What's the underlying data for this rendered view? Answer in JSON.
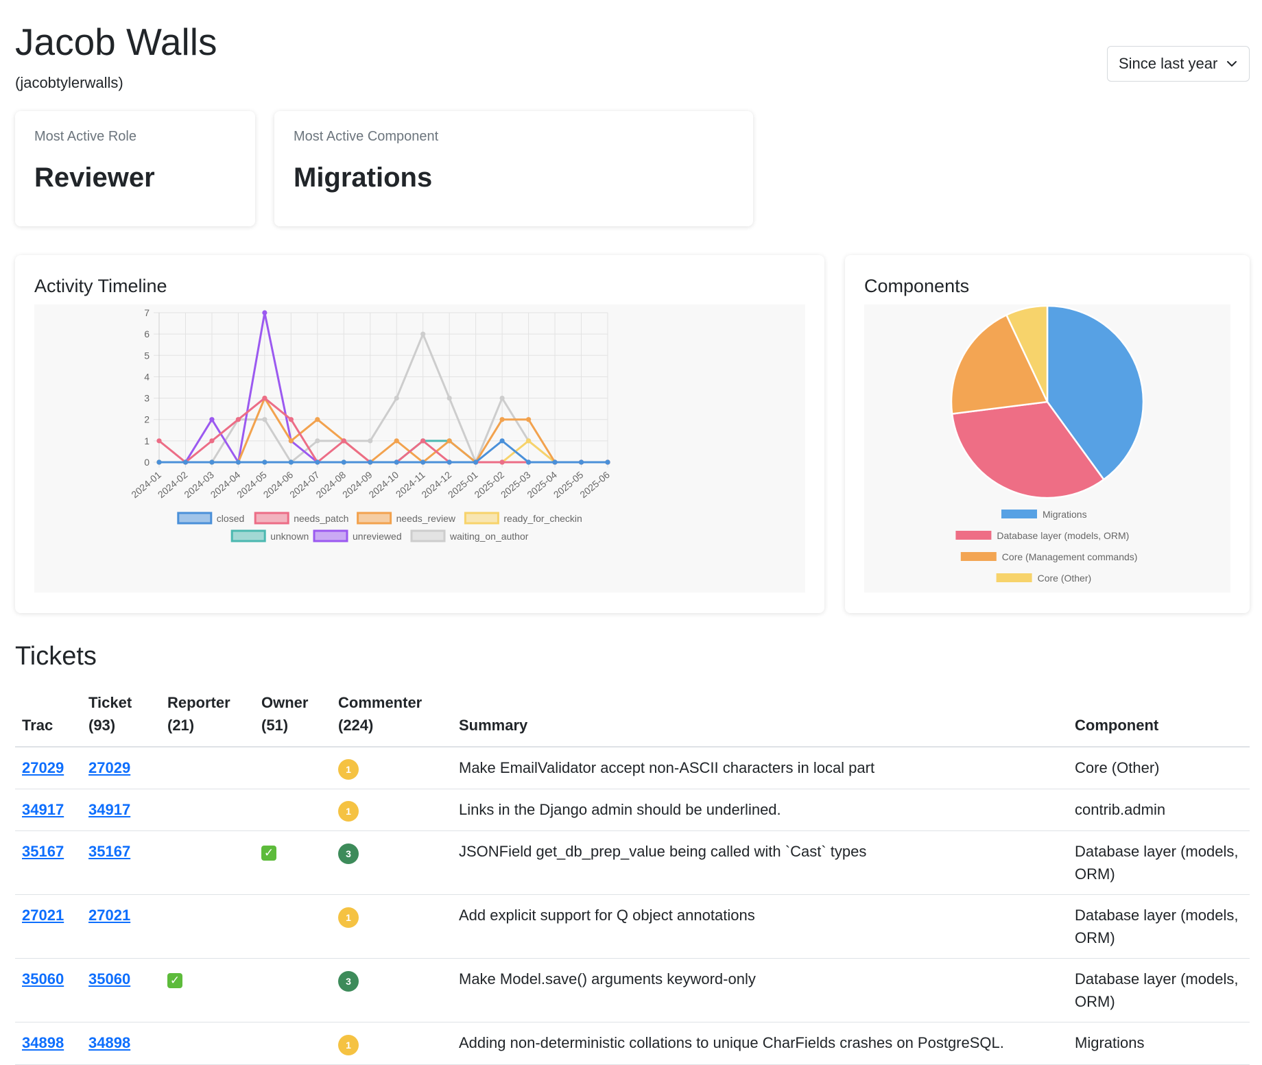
{
  "header": {
    "name": "Jacob Walls",
    "username": "(jacobtylerwalls)",
    "period_selected": "Since last year"
  },
  "stats": {
    "role_label": "Most Active Role",
    "role_value": "Reviewer",
    "component_label": "Most Active Component",
    "component_value": "Migrations"
  },
  "timeline": {
    "title": "Activity Timeline"
  },
  "components": {
    "title": "Components"
  },
  "chart_data": [
    {
      "type": "line",
      "x": [
        "2024-01",
        "2024-02",
        "2024-03",
        "2024-04",
        "2024-05",
        "2024-06",
        "2024-07",
        "2024-08",
        "2024-09",
        "2024-10",
        "2024-11",
        "2024-12",
        "2025-01",
        "2025-02",
        "2025-03",
        "2025-04",
        "2025-05",
        "2025-06"
      ],
      "ylim": [
        0,
        7
      ],
      "yticks": [
        0,
        1,
        2,
        3,
        4,
        5,
        6,
        7
      ],
      "grid": true,
      "legend": "bottom",
      "series": [
        {
          "name": "closed",
          "color": "#4a90d9",
          "values": [
            0,
            0,
            0,
            0,
            0,
            0,
            0,
            0,
            0,
            0,
            0,
            0,
            0,
            1,
            0,
            0,
            0,
            0
          ]
        },
        {
          "name": "needs_patch",
          "color": "#ec6d86",
          "values": [
            1,
            0,
            1,
            2,
            3,
            2,
            0,
            1,
            0,
            0,
            1,
            0,
            0,
            0,
            0,
            0,
            0,
            0
          ]
        },
        {
          "name": "needs_review",
          "color": "#f2a24e",
          "values": [
            0,
            0,
            0,
            0,
            3,
            1,
            2,
            1,
            0,
            1,
            0,
            1,
            0,
            2,
            2,
            0,
            0,
            0
          ]
        },
        {
          "name": "ready_for_checkin",
          "color": "#f7d36b",
          "values": [
            0,
            0,
            0,
            0,
            0,
            0,
            0,
            0,
            0,
            0,
            0,
            0,
            0,
            0,
            1,
            0,
            0,
            0
          ]
        },
        {
          "name": "unknown",
          "color": "#4bb8b0",
          "values": [
            0,
            0,
            0,
            0,
            0,
            0,
            0,
            0,
            0,
            0,
            1,
            1,
            0,
            0,
            0,
            0,
            0,
            0
          ]
        },
        {
          "name": "unreviewed",
          "color": "#9b59f0",
          "values": [
            0,
            0,
            2,
            0,
            7,
            1,
            0,
            0,
            0,
            0,
            0,
            0,
            0,
            0,
            0,
            0,
            0,
            0
          ]
        },
        {
          "name": "waiting_on_author",
          "color": "#cdcdcd",
          "values": [
            0,
            0,
            0,
            2,
            2,
            0,
            1,
            1,
            1,
            3,
            6,
            3,
            0,
            3,
            1,
            0,
            0,
            0
          ]
        }
      ]
    },
    {
      "type": "pie",
      "legend": "bottom",
      "categories": [
        "Migrations",
        "Database layer (models, ORM)",
        "Core (Management commands)",
        "Core (Other)"
      ],
      "values": [
        40,
        33,
        20,
        7
      ],
      "colors": [
        "#57a1e4",
        "#ee6e85",
        "#f3a553",
        "#f7d36b"
      ]
    }
  ],
  "tickets": {
    "heading": "Tickets",
    "columns": {
      "trac": "Trac",
      "ticket": "Ticket",
      "ticket_count": "(93)",
      "reporter": "Reporter",
      "reporter_count": "(21)",
      "owner": "Owner",
      "owner_count": "(51)",
      "commenter": "Commenter",
      "commenter_count": "(224)",
      "summary": "Summary",
      "component": "Component"
    },
    "rows": [
      {
        "trac": "27029",
        "ticket": "27029",
        "reporter": "",
        "owner": "",
        "commenter": "1",
        "summary": "Make EmailValidator accept non-ASCII characters in local part",
        "component": "Core (Other)"
      },
      {
        "trac": "34917",
        "ticket": "34917",
        "reporter": "",
        "owner": "",
        "commenter": "1",
        "summary": "Links in the Django admin should be underlined.",
        "component": "contrib.admin"
      },
      {
        "trac": "35167",
        "ticket": "35167",
        "reporter": "",
        "owner": "✓",
        "commenter": "3",
        "summary": "JSONField get_db_prep_value being called with `Cast` types",
        "component": "Database layer (models, ORM)"
      },
      {
        "trac": "27021",
        "ticket": "27021",
        "reporter": "",
        "owner": "",
        "commenter": "1",
        "summary": "Add explicit support for Q object annotations",
        "component": "Database layer (models, ORM)"
      },
      {
        "trac": "35060",
        "ticket": "35060",
        "reporter": "✓",
        "owner": "",
        "commenter": "3",
        "summary": "Make Model.save() arguments keyword-only",
        "component": "Database layer (models, ORM)"
      },
      {
        "trac": "34898",
        "ticket": "34898",
        "reporter": "",
        "owner": "",
        "commenter": "1",
        "summary": "Adding non-deterministic collations to unique CharFields crashes on PostgreSQL.",
        "component": "Migrations"
      }
    ]
  }
}
